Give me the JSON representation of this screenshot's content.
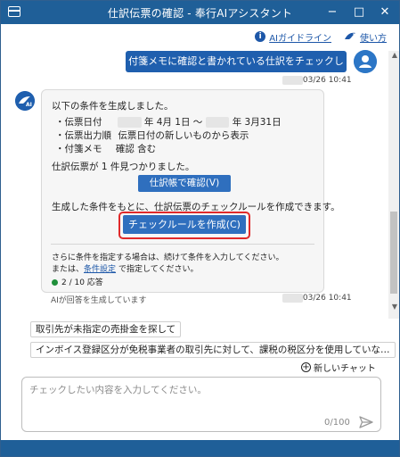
{
  "window": {
    "title": "仕訳伝票の確認 - 奉行AIアシスタント"
  },
  "header_links": {
    "ai_guideline": "AIガイドライン",
    "how_to_use": "使い方"
  },
  "user_message": {
    "text": "付箋メモに確認と書かれている仕訳をチェックして",
    "time": "03/26 10:41"
  },
  "assistant_message": {
    "intro": "以下の条件を生成しました。",
    "conditions": [
      {
        "label": "・伝票日付",
        "value_pre": "年 4月 1日 ～",
        "value_post": "年 3月31日"
      },
      {
        "label": "・伝票出力順",
        "value": "伝票日付の新しいものから表示"
      },
      {
        "label": "・付箋メモ",
        "value": "確認 含む"
      }
    ],
    "found": "仕訳伝票が 1 件見つかりました。",
    "btn_ledger": "仕訳帳で確認(V)",
    "create_rule_text": "生成した条件をもとに、仕訳伝票のチェックルールを作成できます。",
    "btn_create_rule": "チェックルールを作成(C)",
    "note_line1": "さらに条件を指定する場合は、続けて条件を入力してください。",
    "note_line2_pre": "または、",
    "note_link": "条件設定",
    "note_line2_post": "で指定してください。",
    "answers": "2 / 10 応答",
    "generation_status": "AIが回答を生成しています",
    "time": "03/26 10:41"
  },
  "suggestions": [
    "取引先が未指定の売掛金を探して",
    "インボイス登録区分が免税事業者の取引先に対して、課税の税区分を使用していな…"
  ],
  "new_chat": "新しいチャット",
  "input": {
    "placeholder": "チェックしたい内容を入力してください。",
    "counter": "0/100"
  },
  "colors": {
    "titlebar": "#1f5f98",
    "primary_button": "#2f6fbe",
    "highlight": "#e0292a"
  }
}
